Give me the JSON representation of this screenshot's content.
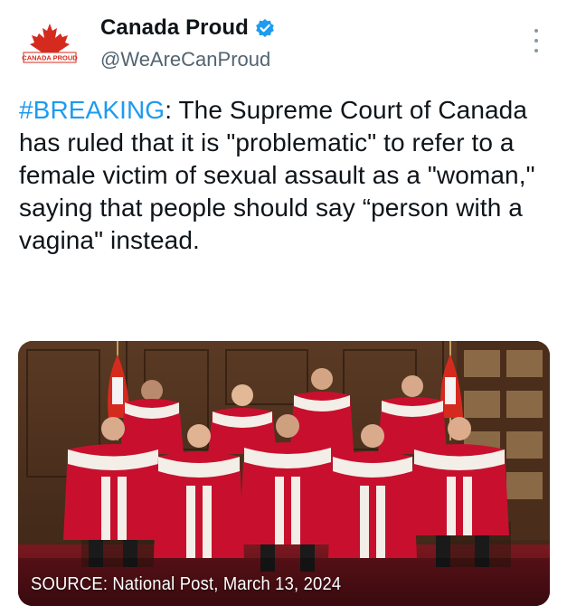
{
  "account": {
    "display_name": "Canada Proud",
    "handle": "@WeAreCanProud",
    "verified": true,
    "avatar_logo_text": "CANADA PROUD"
  },
  "tweet": {
    "hashtag": "#BREAKING",
    "body": ": The Supreme Court of Canada has ruled that it is \"problematic\" to refer to a female victim of sexual assault as a \"woman,\" saying that people should say “person with a vagina\" instead."
  },
  "media": {
    "caption": "SOURCE: National Post, March 13, 2024"
  },
  "icons": {
    "verified": "verified-badge-icon",
    "more": "more-options-icon"
  },
  "colors": {
    "link": "#1d9bf0",
    "verified": "#1d9bf0",
    "robe_red": "#c8102e",
    "handle_gray": "#536471"
  }
}
